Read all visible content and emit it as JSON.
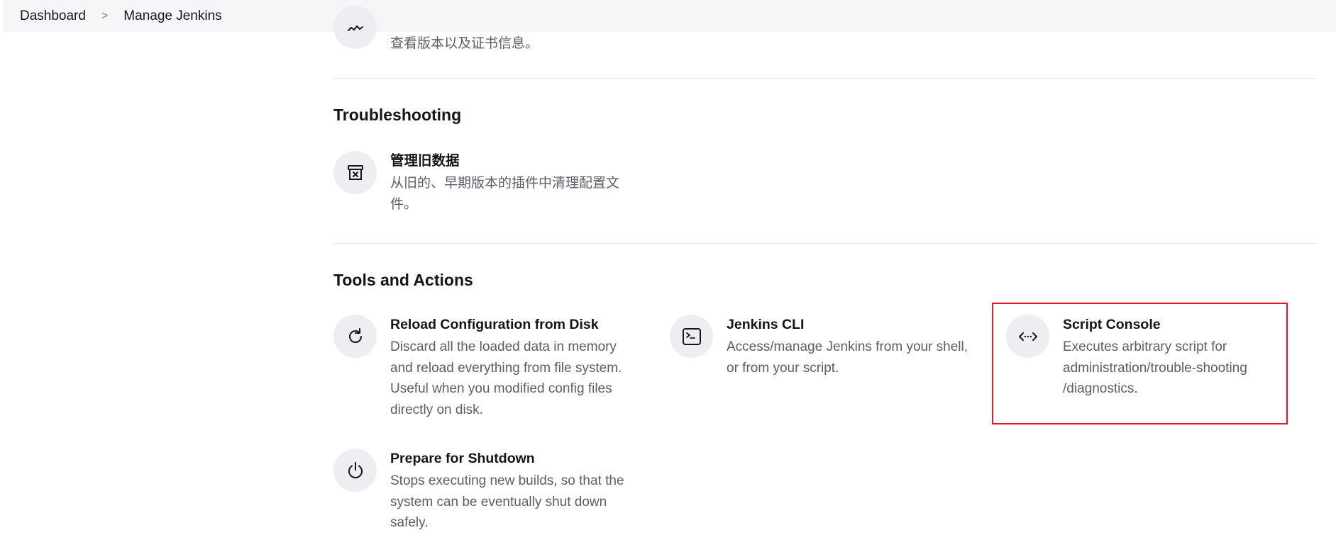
{
  "breadcrumb": {
    "items": [
      "Dashboard",
      "Manage Jenkins"
    ],
    "separator": ">"
  },
  "partial_item": {
    "desc": "查看版本以及证书信息。",
    "icon": "certificate-icon"
  },
  "sections": {
    "troubleshooting": {
      "title": "Troubleshooting",
      "items": [
        {
          "title": "管理旧数据",
          "desc_line1": "从旧的、早期版本的插件中清理配置文",
          "desc_line2": "件。",
          "icon": "archive-box-icon"
        }
      ]
    },
    "tools": {
      "title": "Tools and Actions",
      "items": [
        {
          "title": "Reload Configuration from Disk",
          "desc": "Discard all the loaded data in memory and reload everything from file system. Useful when you modified config files directly on disk.",
          "icon": "reload-icon"
        },
        {
          "title": "Jenkins CLI",
          "desc": "Access/manage Jenkins from your shell, or from your script.",
          "icon": "terminal-icon"
        },
        {
          "title": "Script Console",
          "desc": "Executes arbitrary script for administration/trouble-shooting /diagnostics.",
          "icon": "code-icon",
          "highlighted": true
        },
        {
          "title": "Prepare for Shutdown",
          "desc": "Stops executing new builds, so that the system can be eventually shut down safely.",
          "icon": "power-icon"
        }
      ]
    }
  },
  "colors": {
    "highlight": "#e01a22",
    "icon_bg": "#eeeef2",
    "topbar_bg": "#f6f6f8"
  }
}
